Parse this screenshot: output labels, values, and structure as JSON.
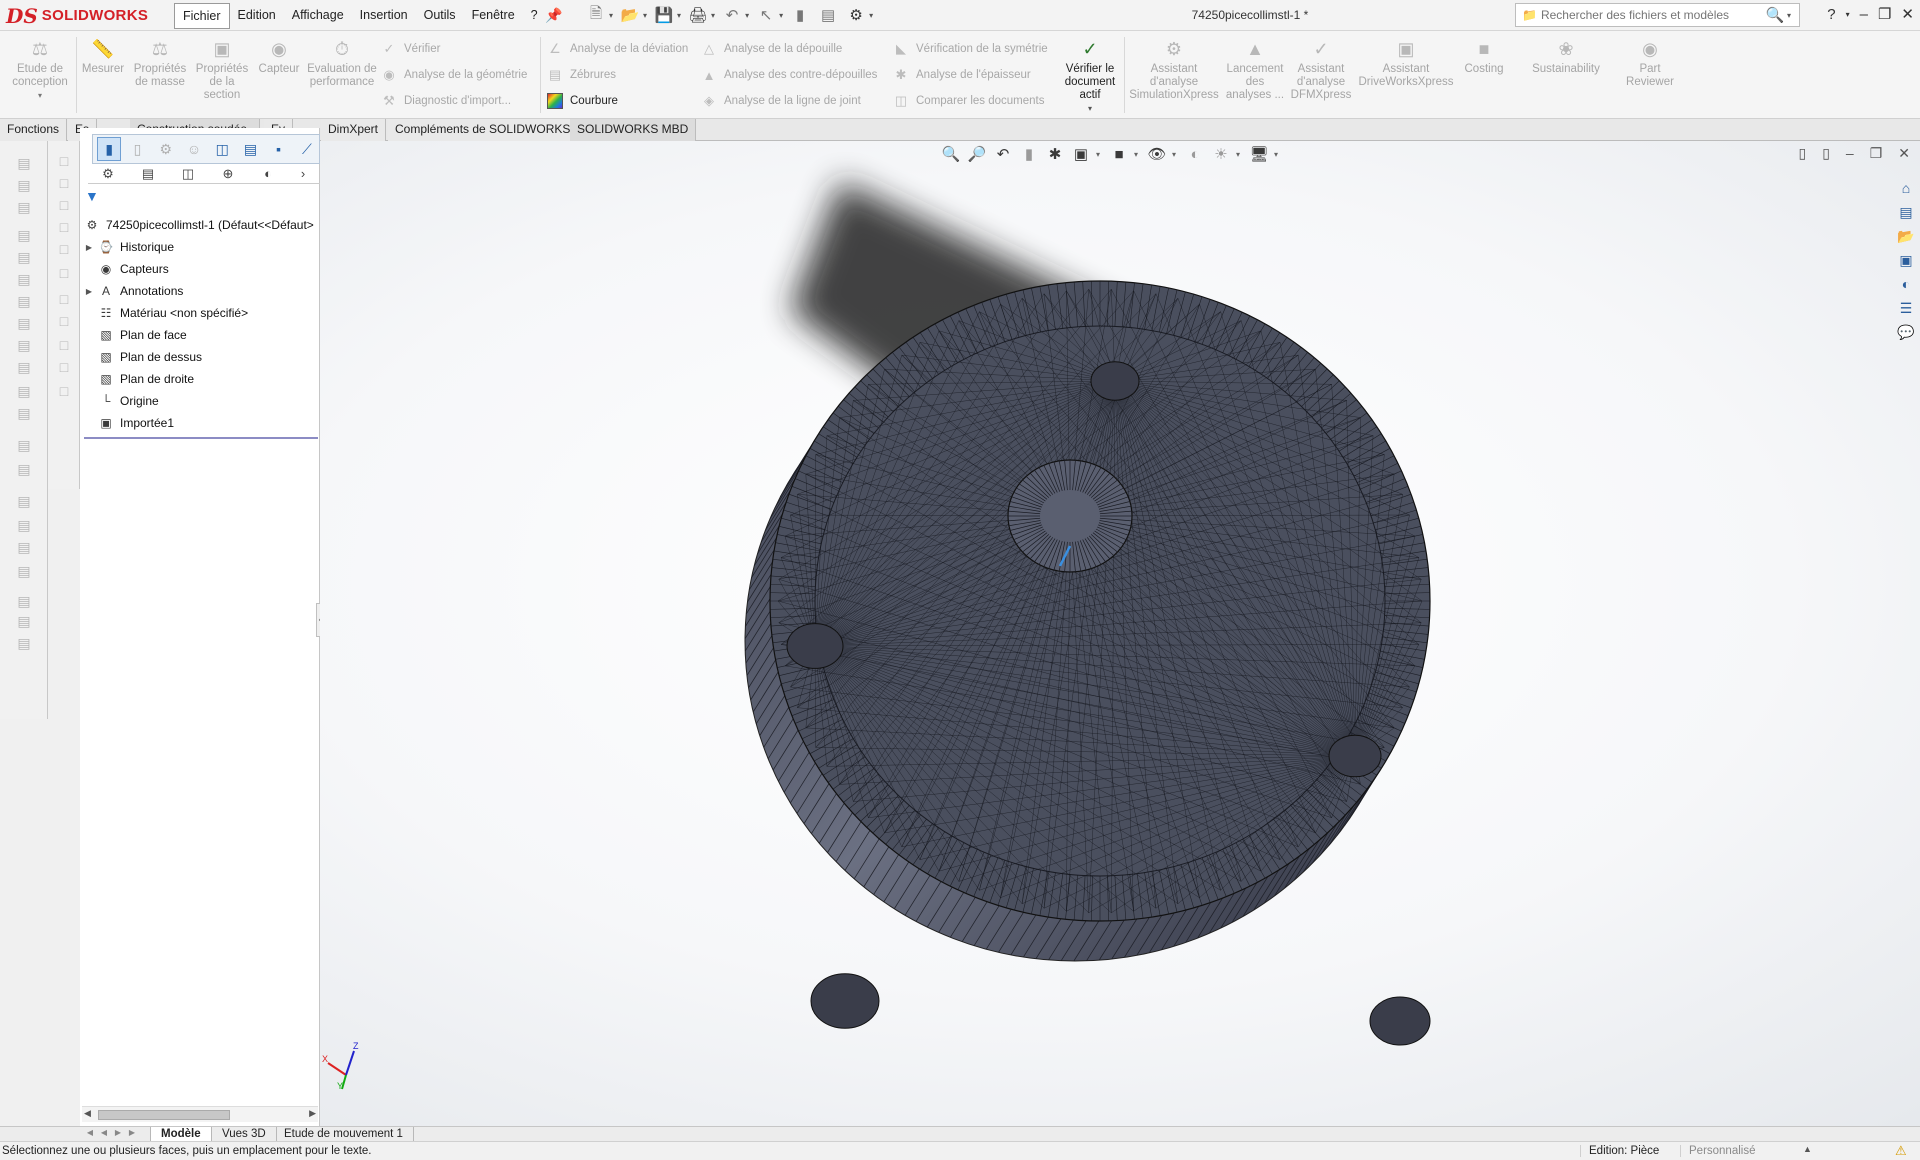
{
  "app": {
    "logo_prefix": "DS",
    "logo_name": "SOLIDWORKS",
    "document_title": "74250picecollimstl-1 *"
  },
  "menu": [
    "Fichier",
    "Edition",
    "Affichage",
    "Insertion",
    "Outils",
    "Fenêtre",
    "?"
  ],
  "search": {
    "placeholder": "Rechercher des fichiers et modèles"
  },
  "ribbon": {
    "etude": "Etude de conception",
    "mesurer": "Mesurer",
    "proprietes_masse": "Propriétés de masse",
    "proprietes_section": "Propriétés de la section",
    "capteur": "Capteur",
    "evaluation": "Evaluation de performance",
    "verifier": "Vérifier",
    "analyse_geometrie": "Analyse de la géométrie",
    "diagnostic": "Diagnostic d'import...",
    "analyse_deviation": "Analyse de la déviation",
    "zebrures": "Zébrures",
    "courbure": "Courbure",
    "analyse_depouille": "Analyse de la dépouille",
    "analyse_contre": "Analyse des contre-dépouilles",
    "analyse_ligne": "Analyse de la ligne de joint",
    "verif_symetrie": "Vérification de la symétrie",
    "analyse_epaisseur": "Analyse de l'épaisseur",
    "comparer": "Comparer les documents",
    "verifier_doc": "Vérifier le document actif",
    "assistant_sim": "Assistant d'analyse SimulationXpress",
    "lancement": "Lancement des analyses ...",
    "assistant_dfm": "Assistant d'analyse DFMXpress",
    "assistant_drive": "Assistant DriveWorksXpress",
    "costing": "Costing",
    "sustainability": "Sustainability",
    "part_reviewer": "Part Reviewer"
  },
  "command_tabs": [
    "Fonctions",
    "Es",
    "Construction soudée",
    "Ev",
    "DimXpert",
    "Compléments de SOLIDWORKS",
    "SOLIDWORKS MBD"
  ],
  "tree": {
    "root": "74250picecollimstl-1  (Défaut<<Défaut>",
    "items": [
      {
        "label": "Historique",
        "icon": "history-icon",
        "expandable": true
      },
      {
        "label": "Capteurs",
        "icon": "sensor-icon",
        "expandable": false
      },
      {
        "label": "Annotations",
        "icon": "annotations-icon",
        "expandable": true
      },
      {
        "label": "Matériau <non spécifié>",
        "icon": "material-icon",
        "expandable": false
      },
      {
        "label": "Plan de face",
        "icon": "plane-icon",
        "expandable": false
      },
      {
        "label": "Plan de dessus",
        "icon": "plane-icon",
        "expandable": false
      },
      {
        "label": "Plan de droite",
        "icon": "plane-icon",
        "expandable": false
      },
      {
        "label": "Origine",
        "icon": "origin-icon",
        "expandable": false
      },
      {
        "label": "Importée1",
        "icon": "imported-body-icon",
        "expandable": false
      }
    ]
  },
  "bottom_tabs": [
    "Modèle",
    "Vues 3D",
    "Etude de mouvement 1"
  ],
  "status": {
    "message": "Sélectionnez une ou plusieurs faces, puis un emplacement pour le texte.",
    "mode": "Edition: Pièce",
    "units": "Personnalisé"
  },
  "triad": {
    "x": "X",
    "y": "Y",
    "z": "Z"
  },
  "colors": {
    "brand": "#d42027",
    "accent": "#2a74c9",
    "mesh": "#4a4f5e"
  }
}
